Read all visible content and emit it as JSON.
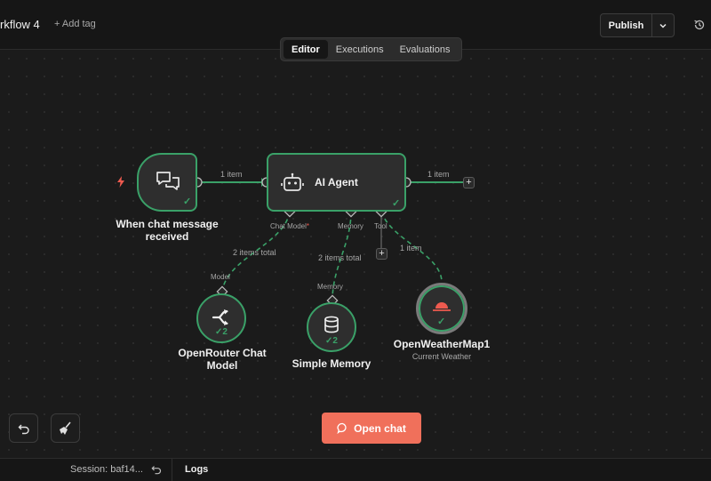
{
  "header": {
    "workflow_title": "rkflow 4",
    "add_tag_label": "+ Add tag",
    "publish_label": "Publish",
    "icons": {
      "publish_menu": "chevron-down-icon",
      "history": "history-icon"
    }
  },
  "tabs": [
    {
      "label": "Editor",
      "active": true
    },
    {
      "label": "Executions",
      "active": false
    },
    {
      "label": "Evaluations",
      "active": false
    }
  ],
  "canvas": {
    "trigger_node": {
      "label_line1": "When chat message",
      "label_line2": "received",
      "icon": "chat-bubbles-icon",
      "trigger_icon": "lightning-bolt-icon",
      "status": "success"
    },
    "agent_node": {
      "title": "AI Agent",
      "icon": "robot-icon",
      "status": "success",
      "ports": {
        "chat_model": "Chat Model",
        "required_mark": "*",
        "memory": "Memory",
        "tool": "Tool"
      }
    },
    "connections": {
      "trigger_to_agent": "1 item",
      "agent_output": "1 item",
      "model_items": "2 items total",
      "memory_items": "2 items total",
      "tool_items": "1 item"
    },
    "sub_nodes": [
      {
        "id": "openrouter",
        "label_line1": "OpenRouter Chat",
        "label_line2": "Model",
        "port_label": "Model",
        "icon": "openrouter-icon",
        "run_count": "2"
      },
      {
        "id": "memory",
        "label_line1": "Simple Memory",
        "port_label": "Memory",
        "icon": "database-icon",
        "run_count": "2"
      },
      {
        "id": "weather",
        "label_line1": "OpenWeatherMap1",
        "subtitle": "Current Weather",
        "icon": "sunset-icon",
        "status": "success"
      }
    ]
  },
  "toolbar": {
    "undo_icon": "undo-icon",
    "clear_icon": "broom-icon"
  },
  "chat_button": {
    "label": "Open chat",
    "icon": "chat-bubble-icon"
  },
  "bottom_panel": {
    "session_label": "Session: baf14...",
    "reset_icon": "undo-icon",
    "logs_label": "Logs"
  },
  "colors": {
    "success": "#3aa168",
    "accent": "#f0705b",
    "background": "#1b1b1b",
    "node": "#2e2e2e"
  }
}
